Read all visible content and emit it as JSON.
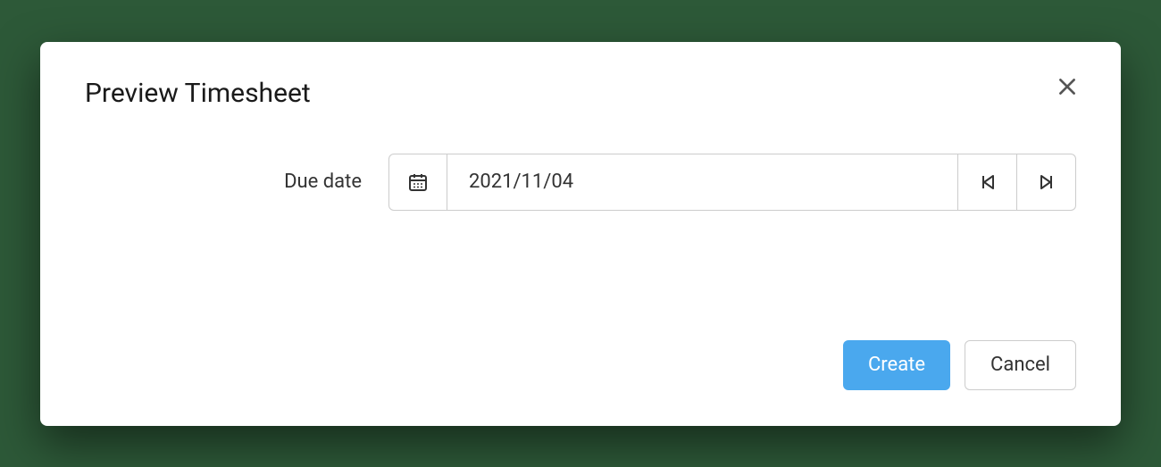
{
  "modal": {
    "title": "Preview Timesheet",
    "dueDateLabel": "Due date",
    "dueDateValue": "2021/11/04",
    "createLabel": "Create",
    "cancelLabel": "Cancel"
  },
  "colors": {
    "accent": "#4aa8ee",
    "border": "#cccccc",
    "text": "#333333",
    "background": "#2d5938"
  }
}
